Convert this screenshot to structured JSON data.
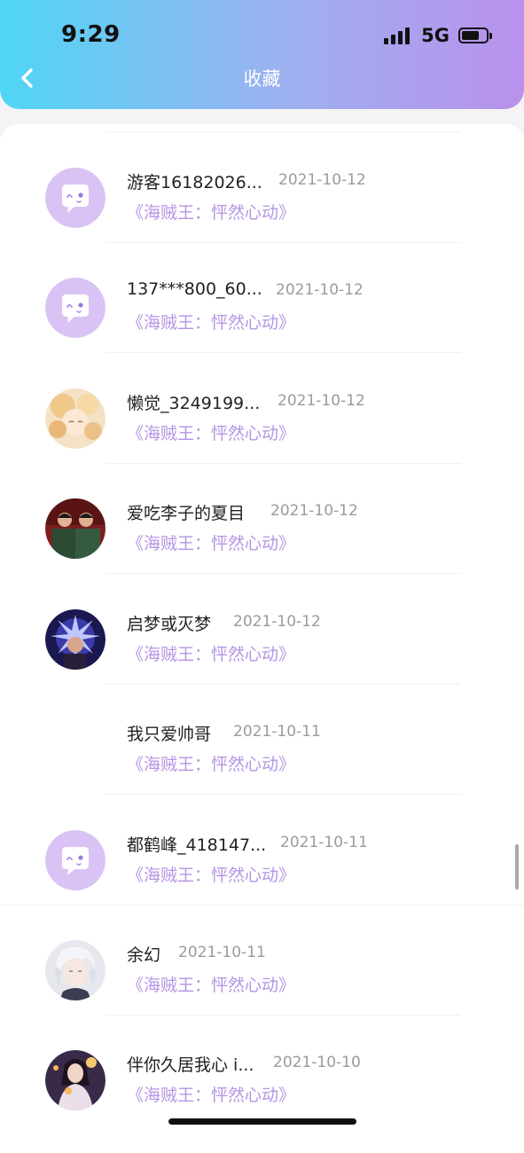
{
  "status_bar": {
    "time": "9:29",
    "network": "5G"
  },
  "nav": {
    "title": "收藏",
    "back_icon": "chevron-left-icon"
  },
  "colors": {
    "accent": "#b595e4",
    "avatar_placeholder": "#d9c3f4"
  },
  "favorites": [
    {
      "name": "游客16182026...",
      "date": "2021-10-12",
      "work": "《海贼王：怦然心动》",
      "avatar": "default"
    },
    {
      "name": "137***800_60...",
      "date": "2021-10-12",
      "work": "《海贼王：怦然心动》",
      "avatar": "default"
    },
    {
      "name": "懒觉_3249199...",
      "date": "2021-10-12",
      "work": "《海贼王：怦然心动》",
      "avatar": "photo"
    },
    {
      "name": "爱吃李子的夏目",
      "date": "2021-10-12",
      "work": "《海贼王：怦然心动》",
      "avatar": "photo"
    },
    {
      "name": "启梦或灭梦",
      "date": "2021-10-12",
      "work": "《海贼王：怦然心动》",
      "avatar": "photo"
    },
    {
      "name": "我只爱帅哥",
      "date": "2021-10-11",
      "work": "《海贼王：怦然心动》",
      "avatar": "none"
    },
    {
      "name": "都鹤峰_418147...",
      "date": "2021-10-11",
      "work": "《海贼王：怦然心动》",
      "avatar": "default"
    },
    {
      "name": "余幻",
      "date": "2021-10-11",
      "work": "《海贼王：怦然心动》",
      "avatar": "photo"
    },
    {
      "name": "伴你久居我心 i...",
      "date": "2021-10-10",
      "work": "《海贼王：怦然心动》",
      "avatar": "photo"
    }
  ]
}
